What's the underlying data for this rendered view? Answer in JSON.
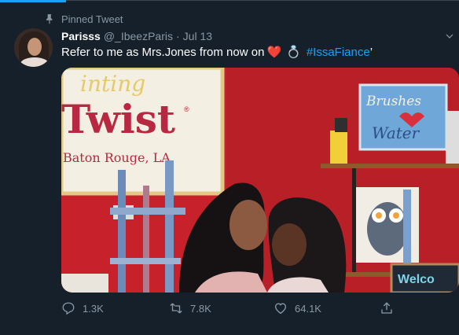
{
  "pinned": {
    "label": "Pinned Tweet",
    "icon": "pin-icon"
  },
  "tweet": {
    "author": {
      "display_name": "Parisss",
      "handle": "@_IbeezParis",
      "separator": "·",
      "date": "Jul 13"
    },
    "text": "Refer to me as Mrs.Jones from now on",
    "emojis": [
      "❤️",
      "💍"
    ],
    "hashtag": "#IssaFiance",
    "trailing": "’"
  },
  "media": {
    "sign": {
      "arc_text": "inting",
      "brand": "Twist",
      "registered": "®",
      "location": "Baton Rouge, LA"
    },
    "canvas_text": {
      "line1": "Brushes",
      "line2": "Water"
    },
    "welcome_sign": "Welco"
  },
  "actions": {
    "reply_count": "1.3K",
    "retweet_count": "7.8K",
    "like_count": "64.1K"
  },
  "colors": {
    "background": "#15202b",
    "accent": "#1da1f2",
    "muted": "#8899a6",
    "heart": "#e0245e"
  }
}
